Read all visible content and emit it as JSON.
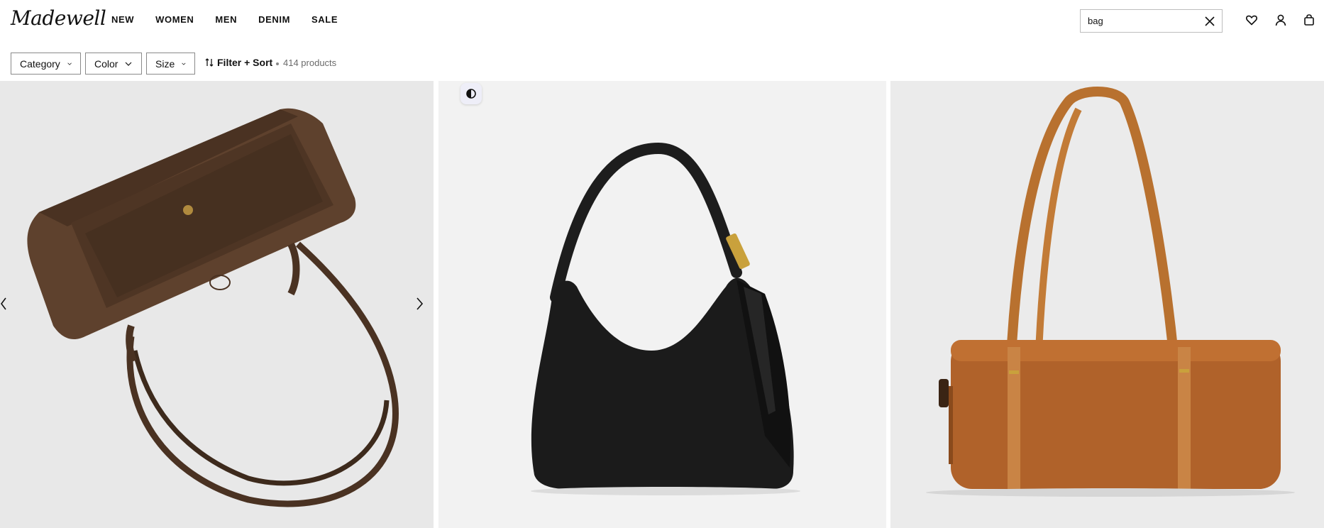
{
  "brand": {
    "logo_text": "Madewell"
  },
  "nav": {
    "items": [
      "NEW",
      "WOMEN",
      "MEN",
      "DENIM",
      "SALE"
    ]
  },
  "search": {
    "value": "bag",
    "clear_icon": "close-icon"
  },
  "header_icons": [
    "heart-icon",
    "user-icon",
    "bag-icon"
  ],
  "filters": {
    "category_label": "Category",
    "color_label": "Color",
    "size_label": "Size",
    "filter_sort_label": "Filter + Sort",
    "product_count": "414 products"
  },
  "products": [
    {
      "name": "brown-suede-shoulder-bag",
      "color": "#5a3e2b",
      "bg": "#e8e8e8"
    },
    {
      "name": "black-leather-hobo-bag",
      "color": "#1b1b1b",
      "bg": "#f2f2f2"
    },
    {
      "name": "tan-leather-barrel-bag",
      "color": "#b0622a",
      "bg": "#ebebeb"
    }
  ],
  "overlay_icon": "half-circle-icon"
}
